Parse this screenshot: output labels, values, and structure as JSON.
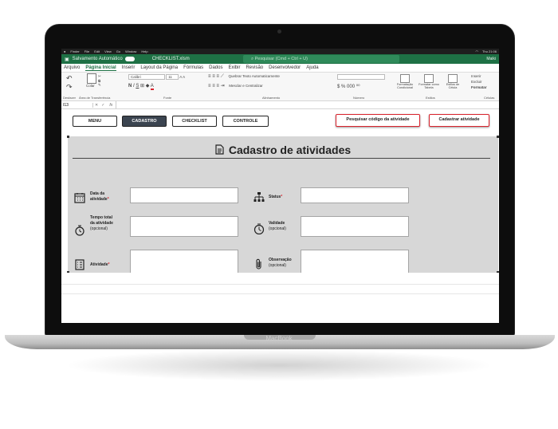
{
  "macos_menu": [
    "Finder",
    "File",
    "Edit",
    "View",
    "Go",
    "Window",
    "Help"
  ],
  "macos_status": [
    "WiFi",
    "Thu 21:06"
  ],
  "excel": {
    "autosave": "Salvamento Automático",
    "filename": "CHECKLIST.xlsm",
    "search_placeholder": "Pesquisar (Cmd + Ctrl + U)",
    "user": "Maiki"
  },
  "ribbon_tabs": [
    "Arquivo",
    "Página Inicial",
    "Inserir",
    "Layout da Página",
    "Fórmulas",
    "Dados",
    "Exibir",
    "Revisão",
    "Desenvolvedor",
    "Ajuda"
  ],
  "ribbon": {
    "undo_label": "Desfazer",
    "paste_label": "Colar",
    "clipboard_label": "Área de Transferência",
    "font_name": "Calibri",
    "font_size": "11",
    "font_group": "Fonte",
    "wrap_text": "Quebrar Texto Automaticamente",
    "merge_center": "Mesclar e Centralizar",
    "alignment_group": "Alinhamento",
    "number_group": "Número",
    "cond_format": "Formatação Condicional",
    "format_table": "Formatar como Tabela",
    "cell_styles": "Estilos de Célula",
    "styles_group": "Estilos",
    "insert": "Inserir",
    "delete": "Excluir",
    "format": "Formatar",
    "cells_group": "Células"
  },
  "formula_bar": {
    "cell_ref": "I13",
    "fx": "fx",
    "value": ""
  },
  "nav_buttons": [
    {
      "label": "MENU",
      "active": false
    },
    {
      "label": "CADASTRO",
      "active": true
    },
    {
      "label": "CHECKLIST",
      "active": false
    },
    {
      "label": "CONTROLE",
      "active": false
    }
  ],
  "actions": {
    "search_code": "Pesquisar código da atividade",
    "register": "Cadastrar atividade"
  },
  "form": {
    "title": "Cadastro de atividades",
    "fields": {
      "date": {
        "label1": "Data da",
        "label2": "atividade",
        "req": "*",
        "value": ""
      },
      "status": {
        "label1": "Status",
        "req": "*",
        "value": ""
      },
      "time": {
        "label1": "Tempo total",
        "label2": "da atividade",
        "label3": "(opcional)",
        "value": ""
      },
      "validity": {
        "label1": "Validade",
        "label2": "(opcional)",
        "value": ""
      },
      "activity": {
        "label1": "Atividade",
        "req": "*",
        "value": ""
      },
      "observation": {
        "label1": "Observação",
        "label2": "(opcional)",
        "value": ""
      }
    }
  },
  "device": {
    "brand": "MacBook"
  },
  "colors": {
    "excel_green": "#1e7145",
    "required_red": "#d9232d",
    "active_nav": "#3b4450",
    "form_bg": "#d7d7d7"
  }
}
